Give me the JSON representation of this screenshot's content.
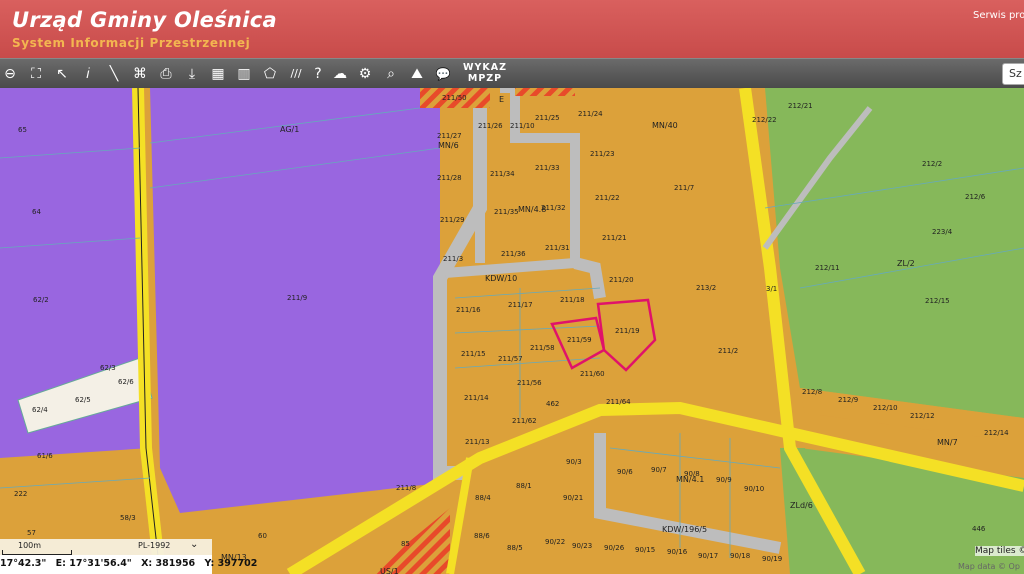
{
  "header": {
    "title": "Urząd Gminy Oleśnica",
    "subtitle": "System Informacji Przestrzennej",
    "service_link": "Serwis prov"
  },
  "toolbar": {
    "tools": [
      {
        "name": "zoom-out-icon",
        "glyph": "⊖"
      },
      {
        "name": "zoom-extent-icon",
        "glyph": "⛶"
      },
      {
        "name": "pointer-icon",
        "glyph": "↖"
      },
      {
        "name": "info-icon",
        "glyph": "𝑖"
      },
      {
        "name": "measure-line-icon",
        "glyph": "╲"
      },
      {
        "name": "measure-area-icon",
        "glyph": "⌘"
      },
      {
        "name": "print-icon",
        "glyph": "⎙"
      },
      {
        "name": "download-icon",
        "glyph": "⤓"
      },
      {
        "name": "layers-icon",
        "glyph": "▦"
      },
      {
        "name": "layout-icon",
        "glyph": "▥"
      },
      {
        "name": "shape-icon",
        "glyph": "⬠"
      },
      {
        "name": "hatch-icon",
        "glyph": "///"
      },
      {
        "name": "help-icon",
        "glyph": "?"
      },
      {
        "name": "cloud-icon",
        "glyph": "☁"
      },
      {
        "name": "settings-icon",
        "glyph": "⚙"
      },
      {
        "name": "search-map-icon",
        "glyph": "⌕"
      },
      {
        "name": "road-icon",
        "glyph": "⛰"
      },
      {
        "name": "chat-icon",
        "glyph": "💬"
      }
    ],
    "wykaz_line1": "WYKAZ",
    "wykaz_line2": "MPZP",
    "search_placeholder": "Sz"
  },
  "map": {
    "zone_labels": [
      "AG/1",
      "MN/40",
      "MN/6",
      "MN/4.8",
      "ZL/2",
      "MN/7",
      "MN/4.1",
      "ZLd/6",
      "MN/13",
      "KDW/10",
      "KDW/196/5",
      "E",
      "US/1"
    ],
    "parcels": [
      "211/50",
      "211/25",
      "211/24",
      "211/27",
      "211/26",
      "211/10",
      "211/23",
      "211/28",
      "211/34",
      "211/33",
      "211/35",
      "211/32",
      "211/7",
      "211/22",
      "211/29",
      "211/21",
      "211/36",
      "211/31",
      "211/3",
      "211/20",
      "213/2",
      "211/18",
      "211/17",
      "211/16",
      "211/19",
      "211/59",
      "211/15",
      "211/57",
      "211/58",
      "211/2",
      "211/60",
      "211/14",
      "211/56",
      "462",
      "211/64",
      "211/62",
      "211/13",
      "211/8",
      "90/3",
      "90/6",
      "90/7",
      "90/8",
      "90/9",
      "90/10",
      "88/4",
      "88/1",
      "90/21",
      "88/6",
      "88/5",
      "90/22",
      "90/23",
      "90/26",
      "90/15",
      "90/16",
      "90/17",
      "90/18",
      "90/19",
      "85",
      "60",
      "58/3",
      "57",
      "222",
      "61/6",
      "62/3",
      "62/6",
      "62/5",
      "62/4",
      "62/2",
      "64",
      "65",
      "211/9",
      "212/21",
      "212/22",
      "212/2",
      "212/6",
      "223/4",
      "212/11",
      "212/15",
      "212/8",
      "212/9",
      "212/10",
      "212/12",
      "212/14",
      "446"
    ]
  },
  "status": {
    "scale_label": "100m",
    "projection": "PL-1992",
    "coord_lat": "17°42.3\"",
    "coord_e": "E: 17°31'56.4\"",
    "coord_x": "X: 381956",
    "coord_y": "Y: 397702"
  },
  "attribution": {
    "map_tiles": "Map tiles ©",
    "map_data": "Map data © Op"
  },
  "colors": {
    "residential": "#dca13a",
    "agricultural": "#9966e0",
    "forest": "#86b85a",
    "road": "#f4e025",
    "header": "#cf5654",
    "selection": "#e0126a"
  }
}
